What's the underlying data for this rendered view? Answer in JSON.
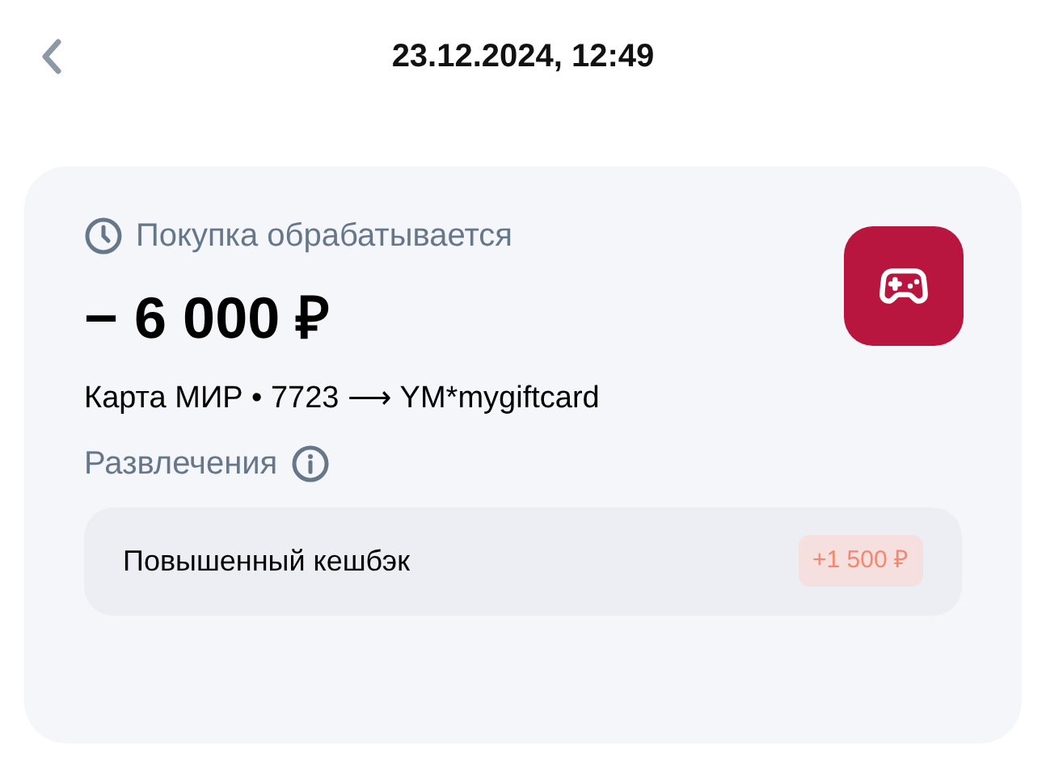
{
  "header": {
    "title": "23.12.2024, 12:49"
  },
  "transaction": {
    "status": "Покупка обрабатывается",
    "amount": "− 6 000 ₽",
    "route": "Карта МИР • 7723 ⟶ YM*mygiftcard",
    "category": "Развлечения",
    "cashback": {
      "label": "Повышенный кешбэк",
      "value": "+1 500 ₽"
    }
  }
}
